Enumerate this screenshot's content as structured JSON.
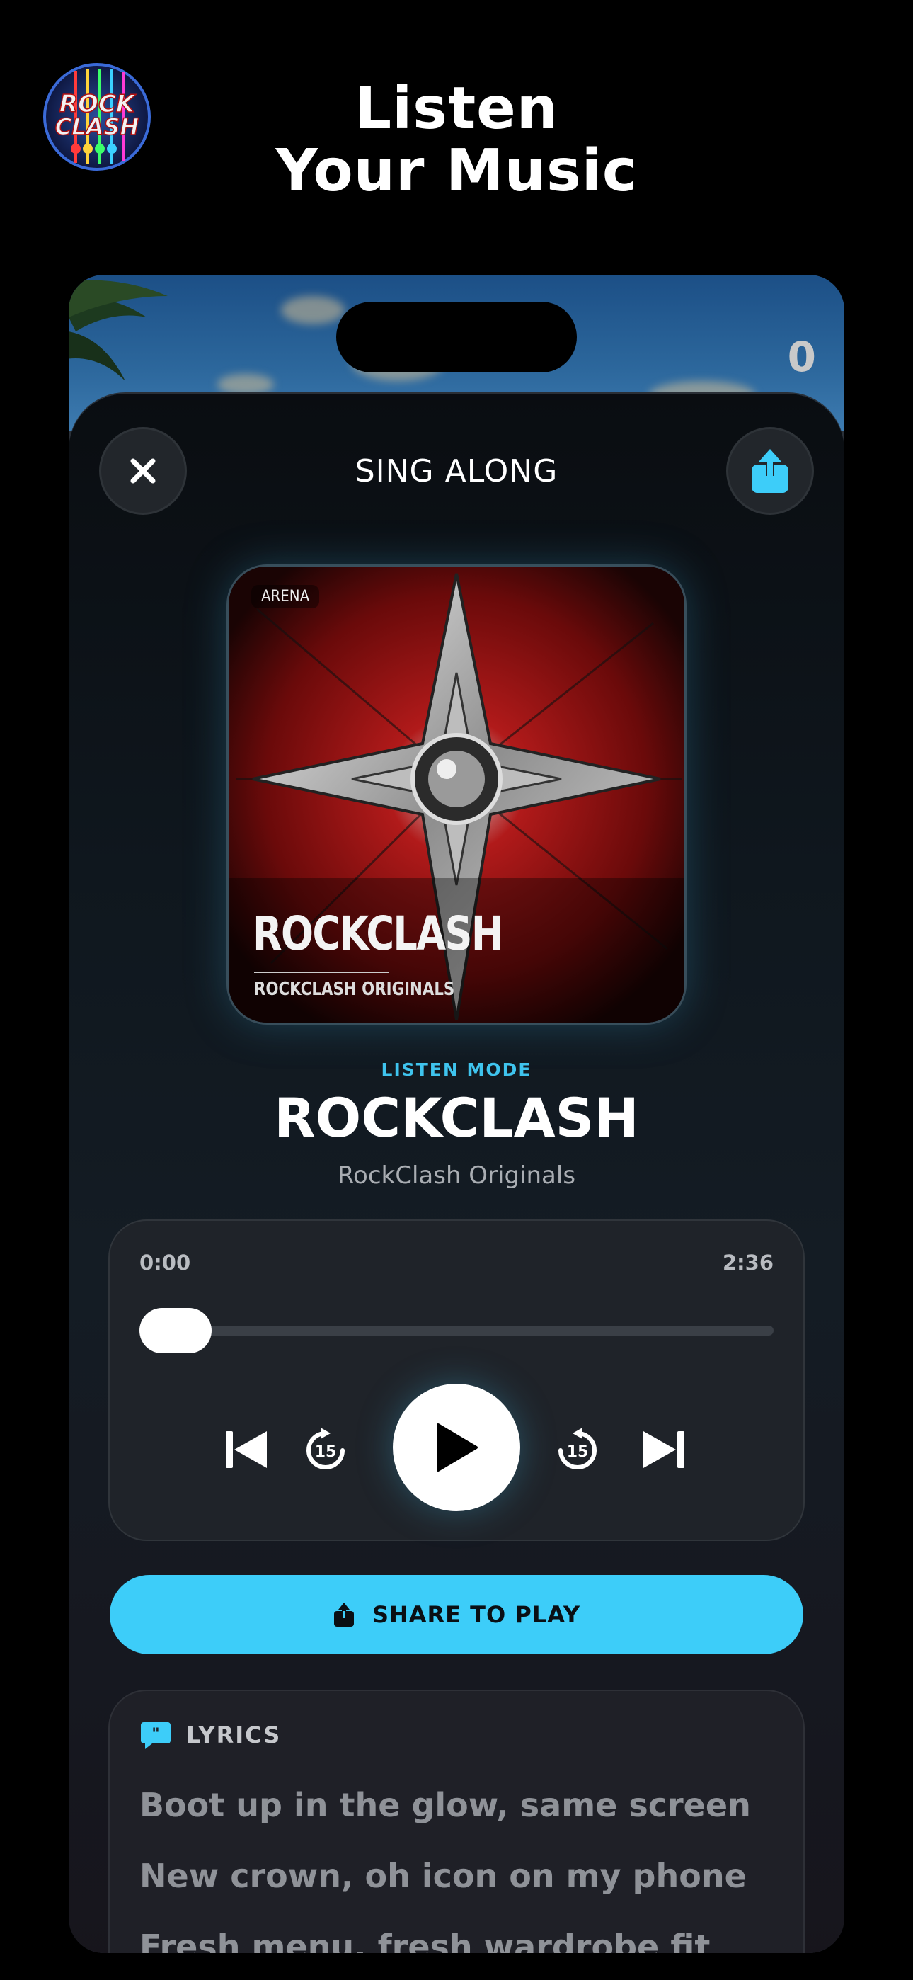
{
  "header": {
    "logo_text_line1": "ROCK",
    "logo_text_line2": "CLASH",
    "headline_line1": "Listen",
    "headline_line2": "Your Music"
  },
  "game_bg": {
    "score": "0"
  },
  "sheet": {
    "title": "SING ALONG",
    "close_icon": "close-icon",
    "share_icon": "share-icon"
  },
  "album": {
    "tag": "ARENA",
    "title": "ROCKCLASH",
    "subtitle": "ROCKCLASH ORIGINALS"
  },
  "track": {
    "mode": "LISTEN MODE",
    "title": "ROCKCLASH",
    "artist": "RockClash Originals"
  },
  "player": {
    "elapsed": "0:00",
    "duration": "2:36",
    "progress": 0.0,
    "skip_seconds": "15"
  },
  "share_button": {
    "label": "SHARE TO PLAY"
  },
  "lyrics": {
    "label": "LYRICS",
    "lines": [
      "Boot up in the glow, same screen",
      "New crown, oh icon on my phone",
      "Fresh menu, fresh wardrobe fit"
    ]
  },
  "colors": {
    "accent": "#3dcdf9",
    "background": "#000000",
    "panel": "#1f2329"
  }
}
